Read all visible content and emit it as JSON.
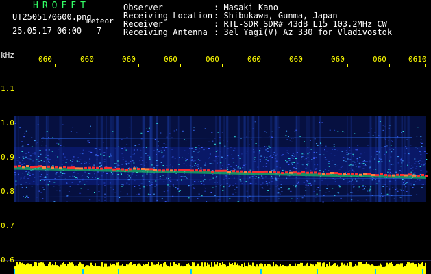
{
  "header": {
    "app_title": "HROFFT",
    "file_name": "UT2505170600.png",
    "station_tag": "meteor",
    "datetime": "25.05.17 06:00",
    "datetime_extra": "7",
    "info": [
      {
        "label": "Observer",
        "value": ": Masaki Kano"
      },
      {
        "label": "Receiving Location",
        "value": ": Shibukawa, Gunma, Japan"
      },
      {
        "label": "Receiver",
        "value": ": RTL-SDR SDR# 43dB L15 103.2MHz CW"
      },
      {
        "label": "Receiving Antenna",
        "value": ": 3el Yagi(V) Az 330 for Vladivostok"
      }
    ]
  },
  "colors": {
    "title_green": "#33ff66",
    "text_white": "#ffffff",
    "axis_yellow": "#ffff00",
    "background": "#000000",
    "echo_line": "#ff3030",
    "noise_blue": "#2040c0",
    "level_bar": "#ffff00",
    "marker_cyan": "#00c8ff"
  },
  "axis": {
    "unit": "kHz",
    "y_ticks": [
      {
        "label": "1.1",
        "value": 1.1
      },
      {
        "label": "1.0",
        "value": 1.0
      },
      {
        "label": "0.9",
        "value": 0.9
      },
      {
        "label": "0.8",
        "value": 0.8
      },
      {
        "label": "0.7",
        "value": 0.7
      },
      {
        "label": "0.6",
        "value": 0.6
      }
    ],
    "x_ticks": [
      "060",
      "060",
      "060",
      "060",
      "060",
      "060",
      "060",
      "060",
      "060",
      "0610"
    ]
  },
  "chart_data": {
    "type": "heatmap",
    "ylabel": "kHz",
    "ylim": [
      0.6,
      1.2
    ],
    "x_tick_labels": [
      "060",
      "060",
      "060",
      "060",
      "060",
      "060",
      "060",
      "060",
      "060",
      "0610"
    ],
    "carrier_line_khz": [
      0.875,
      0.848
    ],
    "noise_band_khz": [
      0.77,
      1.02
    ]
  }
}
